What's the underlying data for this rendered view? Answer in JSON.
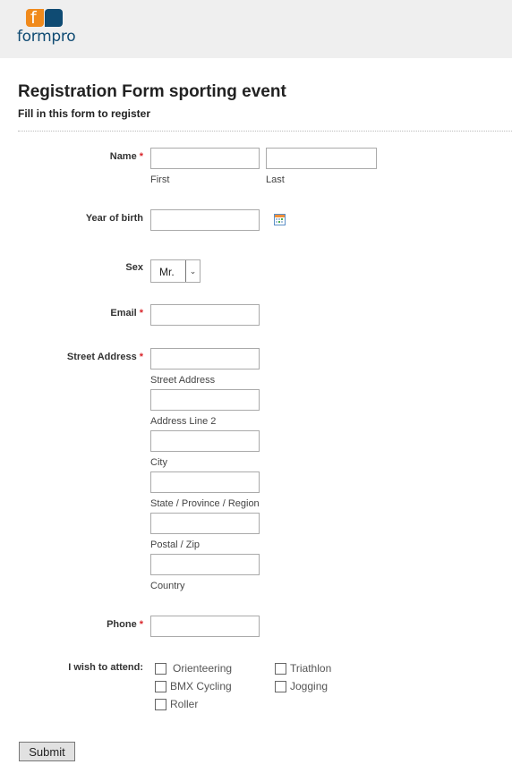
{
  "brand": {
    "logo_letter": "f",
    "logo_text": "formpro",
    "orange": "#f08a1c",
    "blue": "#0f4b73"
  },
  "form": {
    "title": "Registration Form sporting event",
    "subtitle": "Fill in this form to register",
    "required_marker": "*",
    "name": {
      "label": "Name",
      "first_sub": "First",
      "last_sub": "Last",
      "first_value": "",
      "last_value": ""
    },
    "birth": {
      "label": "Year of birth",
      "value": "",
      "icon": "calendar-icon"
    },
    "sex": {
      "label": "Sex",
      "selected": "Mr.",
      "arrow": "⌄"
    },
    "email": {
      "label": "Email",
      "value": ""
    },
    "address": {
      "label": "Street Address",
      "fields": [
        {
          "sub": "Street Address",
          "value": ""
        },
        {
          "sub": "Address Line 2",
          "value": ""
        },
        {
          "sub": "City",
          "value": ""
        },
        {
          "sub": "State / Province / Region",
          "value": ""
        },
        {
          "sub": "Postal / Zip",
          "value": ""
        },
        {
          "sub": "Country",
          "value": ""
        }
      ]
    },
    "phone": {
      "label": "Phone",
      "value": ""
    },
    "attend": {
      "label": "I wish to attend:",
      "options": [
        {
          "label": "Orienteering",
          "checked": false
        },
        {
          "label": "Triathlon",
          "checked": false
        },
        {
          "label": "BMX Cycling",
          "checked": false
        },
        {
          "label": "Jogging",
          "checked": false
        },
        {
          "label": "Roller",
          "checked": false
        }
      ]
    },
    "submit_label": "Submit"
  }
}
